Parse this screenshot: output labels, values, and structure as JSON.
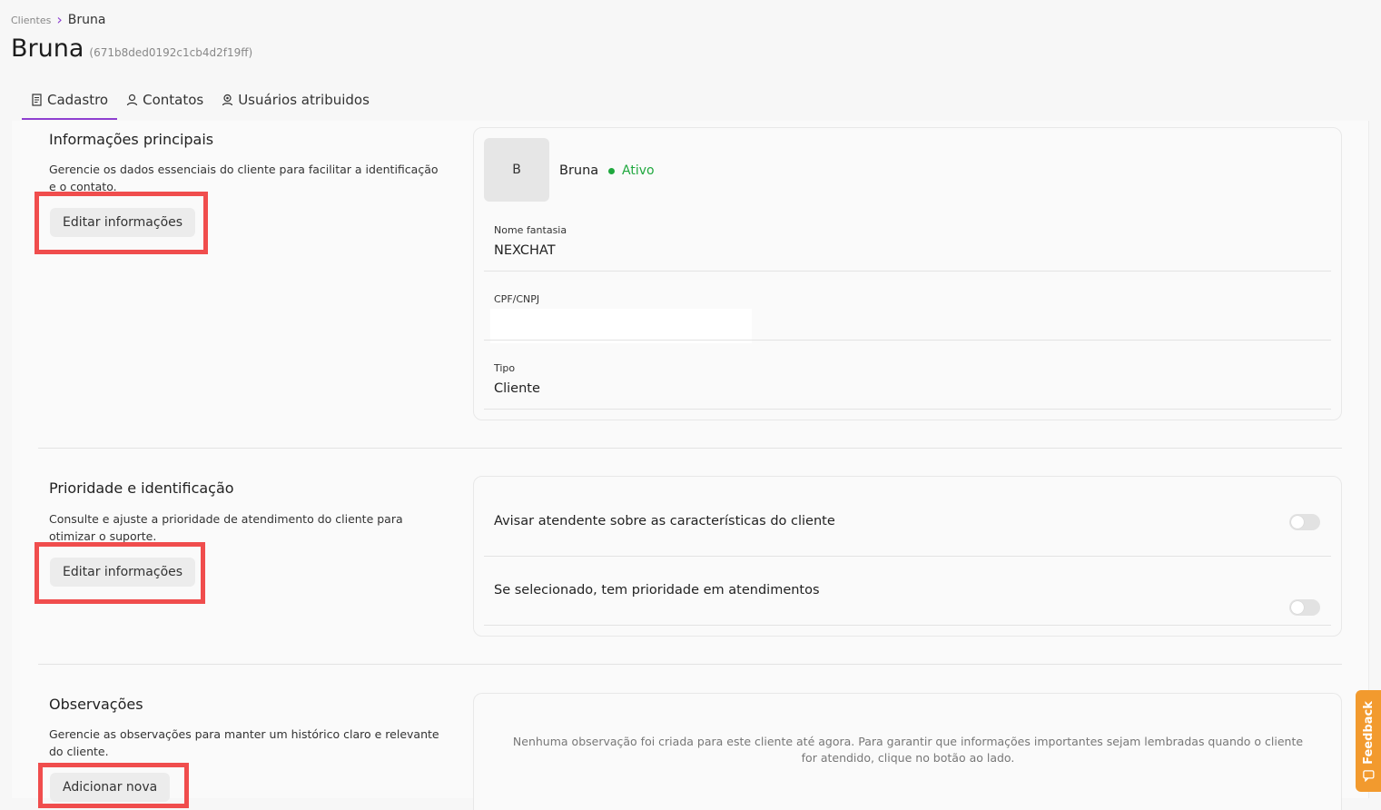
{
  "breadcrumb": {
    "root": "Clientes",
    "current": "Bruna"
  },
  "page": {
    "title": "Bruna",
    "id": "(671b8ded0192c1cb4d2f19ff)"
  },
  "tabs": [
    {
      "label": "Cadastro",
      "icon": "document-icon",
      "active": true
    },
    {
      "label": "Contatos",
      "icon": "user-icon",
      "active": false
    },
    {
      "label": "Usuários atribuidos",
      "icon": "user-badge-icon",
      "active": false
    }
  ],
  "main_info": {
    "title": "Informações principais",
    "description": "Gerencie os dados essenciais do cliente para facilitar a identificação e o contato.",
    "button": "Editar informações",
    "avatar_letter": "B",
    "name": "Bruna",
    "status": "Ativo",
    "fields": [
      {
        "label": "Nome fantasia",
        "value": "NEXCHAT"
      },
      {
        "label": "CPF/CNPJ",
        "value": ""
      },
      {
        "label": "Tipo",
        "value": "Cliente"
      }
    ]
  },
  "priority": {
    "title": "Prioridade e identificação",
    "description": "Consulte e ajuste a prioridade de atendimento do cliente para otimizar o suporte.",
    "button": "Editar informações",
    "options": [
      {
        "label": "Avisar atendente sobre as características do cliente",
        "enabled": false
      },
      {
        "label": "Se selecionado, tem prioridade em atendimentos",
        "enabled": false
      }
    ]
  },
  "notes": {
    "title": "Observações",
    "description": "Gerencie as observações para manter um histórico claro e relevante do cliente.",
    "button": "Adicionar nova",
    "empty_message": "Nenhuma observação foi criada para este cliente até agora. Para garantir que informações importantes sejam lembradas quando o cliente for atendido, clique no botão ao lado."
  },
  "feedback_label": "Feedback",
  "colors": {
    "accent": "#8e3fd0",
    "active": "#1fa83e",
    "highlight": "#f04d4d",
    "feedback": "#f29a2e"
  }
}
